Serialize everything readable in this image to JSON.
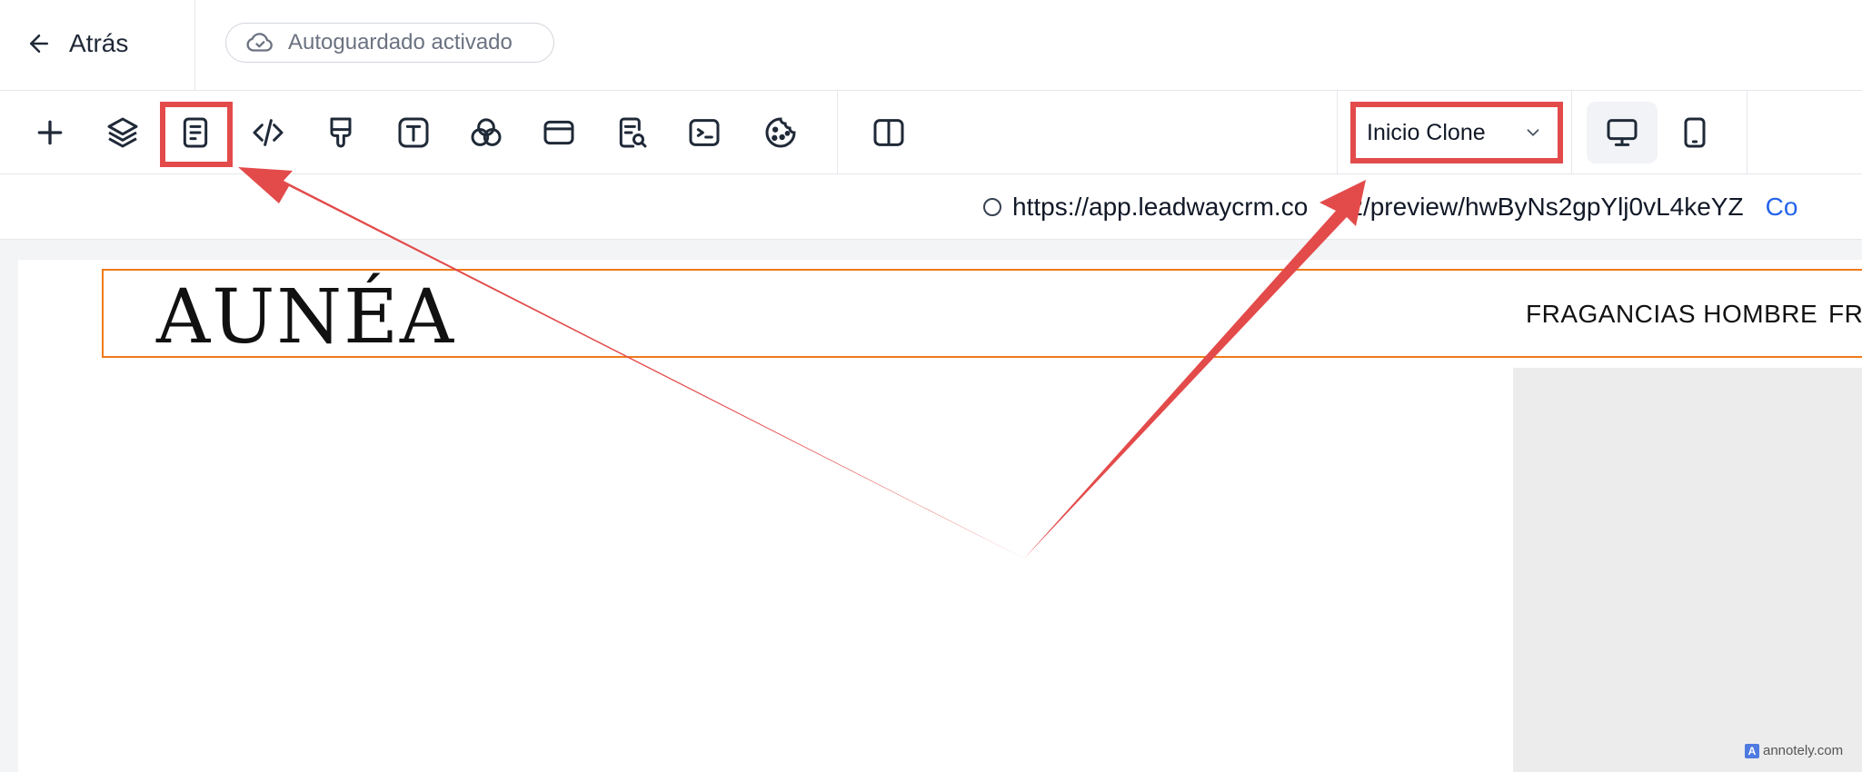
{
  "header": {
    "back_label": "Atrás",
    "autosave_label": "Autoguardado activado"
  },
  "toolbar": {
    "tools": [
      "plus-icon",
      "layers-icon",
      "page-settings-icon",
      "code-icon",
      "brush-icon",
      "typography-icon",
      "colors-icon",
      "browser-window-icon",
      "seo-search-icon",
      "terminal-icon",
      "cookie-icon",
      "split-view-icon"
    ],
    "page_selector": "Inicio Clone",
    "devices": [
      "desktop-icon",
      "mobile-icon"
    ],
    "active_device": "desktop"
  },
  "urlbar": {
    "url": "https://app.leadwaycrm.co    v2/preview/hwByNs2gpYlj0vL4keYZ",
    "copy_label": "Co"
  },
  "preview": {
    "logo": "AUNÉA",
    "nav": [
      "FRAGANCIAS HOMBRE",
      "FRA"
    ]
  },
  "watermark": "annotely.com",
  "colors": {
    "annotation": "#e34b4b",
    "selection": "#f07a1a",
    "link": "#2563eb"
  }
}
